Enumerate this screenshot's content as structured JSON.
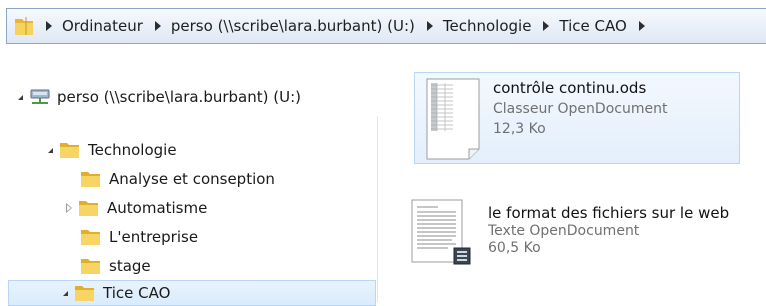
{
  "address_bar": {
    "crumbs": [
      "Ordinateur",
      "perso (\\\\scribe\\lara.burbant) (U:)",
      "Technologie",
      "Tice CAO"
    ]
  },
  "nav_tree": {
    "items": [
      {
        "label": "perso (\\\\scribe\\lara.burbant) (U:)",
        "icon": "network-drive-icon",
        "expanded": true
      },
      {
        "label": "Technologie",
        "icon": "folder-icon",
        "expanded": true
      },
      {
        "label": "Analyse et conseption",
        "icon": "folder-icon"
      },
      {
        "label": "Automatisme",
        "icon": "folder-icon",
        "expanded": false
      },
      {
        "label": "L'entreprise",
        "icon": "folder-icon"
      },
      {
        "label": "stage",
        "icon": "folder-icon"
      },
      {
        "label": "Tice CAO",
        "icon": "folder-icon",
        "expanded": true,
        "selected": true
      }
    ]
  },
  "files": [
    {
      "name": "contrôle continu.ods",
      "type": "Classeur OpenDocument",
      "size": "12,3 Ko",
      "icon": "spreadsheet-document-icon",
      "selected": true
    },
    {
      "name": "le format des  fichiers sur le web",
      "type": "Texte OpenDocument",
      "size": "60,5 Ko",
      "icon": "text-document-icon",
      "selected": false
    }
  ],
  "colors": {
    "selection_bg": "#d9ebfc",
    "selection_border": "#b9d7f5",
    "address_border": "#8fa7c6",
    "folder_yellow": "#f2c44b",
    "secondary_text": "#707070"
  }
}
